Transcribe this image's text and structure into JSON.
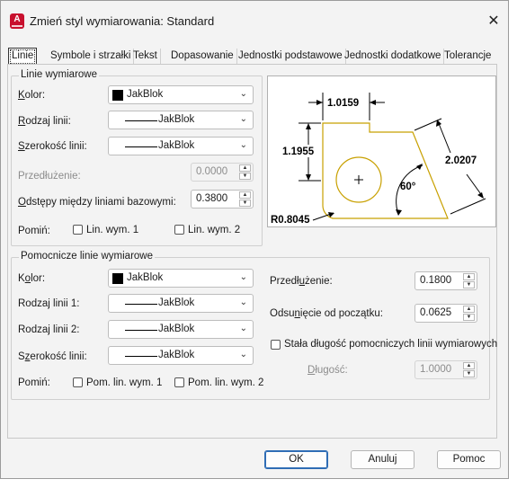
{
  "window": {
    "app_icon": "autocad-a-icon",
    "title": "Zmień styl wymiarowania: Standard",
    "close_glyph": "✕"
  },
  "tabs": [
    {
      "label": "Linie",
      "active": true
    },
    {
      "label": "Symbole i strzałki"
    },
    {
      "label": "Tekst"
    },
    {
      "label": "Dopasowanie"
    },
    {
      "label": "Jednostki podstawowe"
    },
    {
      "label": "Jednostki dodatkowe"
    },
    {
      "label": "Tolerancje"
    }
  ],
  "dim_lines": {
    "group_title": "Linie wymiarowe",
    "color_label": "Kolor:",
    "color_value": "JakBlok",
    "linetype_label": "Rodzaj linii:",
    "linetype_value": "JakBlok",
    "lineweight_label": "Szerokość linii:",
    "lineweight_value": "JakBlok",
    "extension_label": "Przedłużenie:",
    "extension_value": "0.0000",
    "baseline_label": "Odstępy między liniami bazowymi:",
    "baseline_value": "0.3800",
    "suppress_label": "Pomiń:",
    "suppress_1": "Lin. wym. 1",
    "suppress_2": "Lin. wym. 2"
  },
  "ext_lines": {
    "group_title": "Pomocnicze linie wymiarowe",
    "color_label": "Kolor:",
    "color_value": "JakBlok",
    "linetype1_label": "Rodzaj linii 1:",
    "linetype1_value": "JakBlok",
    "linetype2_label": "Rodzaj linii 2:",
    "linetype2_value": "JakBlok",
    "lineweight_label": "Szerokość linii:",
    "lineweight_value": "JakBlok",
    "suppress_label": "Pomiń:",
    "suppress_1": "Pom. lin. wym. 1",
    "suppress_2": "Pom. lin. wym. 2",
    "extend_label": "Przedłużenie:",
    "extend_value": "0.1800",
    "offset_label": "Odsunięcie od początku:",
    "offset_value": "0.0625",
    "fixed_label": "Stała długość pomocniczych linii wymiarowych",
    "length_label": "Długość:",
    "length_value": "1.0000"
  },
  "preview": {
    "dim_top": "1.0159",
    "dim_left": "1.1955",
    "dim_right": "2.0207",
    "dim_angle": "60°",
    "dim_radius": "R0.8045"
  },
  "buttons": {
    "ok": "OK",
    "cancel": "Anuluj",
    "help": "Pomoc"
  },
  "colors": {
    "shape_outline": "#c8a000",
    "primary_border": "#2f6db5"
  }
}
